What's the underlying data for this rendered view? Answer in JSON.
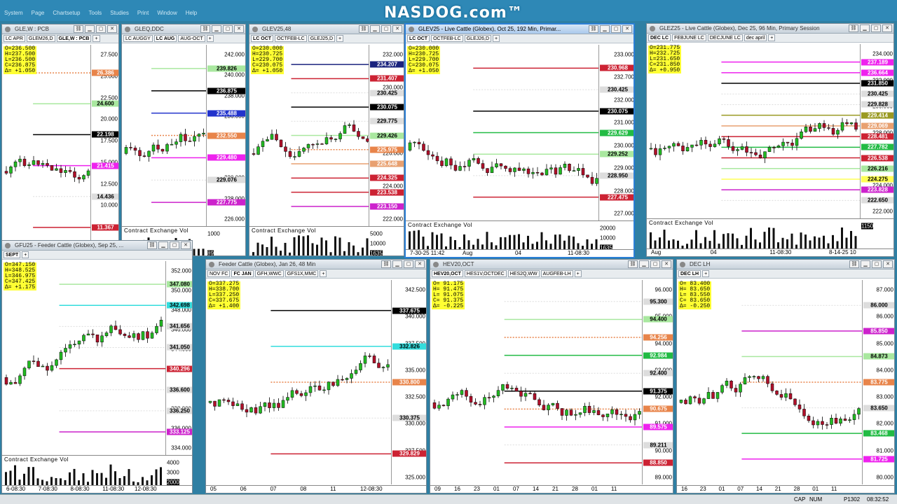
{
  "app": {
    "logo": "NASDOG.com™",
    "menu": [
      "System",
      "Page",
      "Chartsetup",
      "Tools",
      "Studies",
      "Print",
      "Window",
      "Help"
    ]
  },
  "statusbar": {
    "caps": "CAP",
    "num": "NUM",
    "page": "P1302",
    "time": "08:32:52"
  },
  "windows": [
    {
      "id": "w1",
      "title": "GLE,W : PCB",
      "tabs": [
        "LC APR",
        "GLEM26,D",
        "GLE,W : PCB"
      ],
      "sel": 2,
      "ohlc": [
        "O=236.500",
        "H=237.500",
        "L=236.500",
        "C=236.875",
        "Δ= +1.050"
      ],
      "prices": [
        "27.500",
        "25.000",
        "22.500",
        "20.000",
        "17.500",
        "15.000",
        "12.500",
        "10.000",
        "7.500",
        "5.000"
      ],
      "tags": [
        {
          "t": "26.386",
          "c": "#e8844a"
        },
        {
          "t": "24.600",
          "c": "#a9e89f"
        },
        {
          "t": "22.198",
          "c": "#000000",
          "f": "#ffffff"
        },
        {
          "t": "21.415",
          "c": "#ee22ee"
        },
        {
          "t": "14.436",
          "c": "#dddddd"
        },
        {
          "t": "11.367",
          "c": "#cc2233"
        }
      ],
      "xlabels": [],
      "vol_title": ""
    },
    {
      "id": "w2",
      "title": "GLEQ,DDC",
      "tabs": [
        "LC AUGGY",
        "LC AUG",
        "AUG-OCT"
      ],
      "sel": 1,
      "ohlc": [],
      "prices": [
        "242.000",
        "240.000",
        "238.000",
        "236.000",
        "234.000",
        "232.000",
        "230.000",
        "228.000",
        "226.000"
      ],
      "tags": [
        {
          "t": "239.826",
          "c": "#a9e89f"
        },
        {
          "t": "236.875",
          "c": "#000000",
          "f": "#ffffff"
        },
        {
          "t": "235.488",
          "c": "#2233cc"
        },
        {
          "t": "232.550",
          "c": "#e8844a"
        },
        {
          "t": "229.480",
          "c": "#ee22ee"
        },
        {
          "t": "229.076",
          "c": "#dddddd"
        },
        {
          "t": "227.775",
          "c": "#cc22cc"
        }
      ],
      "xlabels": [],
      "vol_title": "Contract Exchange Vol",
      "vol_scale": [
        "1000",
        "89"
      ]
    },
    {
      "id": "w3",
      "title": "GLEV25,48",
      "tabs": [
        "LC OCT",
        "OCTFEB-LC",
        "GLEJ25,D"
      ],
      "sel": 0,
      "ohlc": [
        "O=230.000",
        "H=230.725",
        "L=229.700",
        "C=230.075",
        "Δ= +1.050"
      ],
      "prices": [
        "232.000",
        "230.000",
        "228.000",
        "226.000",
        "224.000",
        "222.000"
      ],
      "tags": [
        {
          "t": "234.207",
          "c": "#1a237e"
        },
        {
          "t": "231.407",
          "c": "#cc2233"
        },
        {
          "t": "230.425",
          "c": "#dddddd"
        },
        {
          "t": "230.075",
          "c": "#000000",
          "f": "#ffffff"
        },
        {
          "t": "229.775",
          "c": "#dddddd"
        },
        {
          "t": "229.426",
          "c": "#a9e89f"
        },
        {
          "t": "225.975",
          "c": "#e8844a"
        },
        {
          "t": "225.648",
          "c": "#e8a070"
        },
        {
          "t": "224.325",
          "c": "#cc2233"
        },
        {
          "t": "223.538",
          "c": "#cc2233"
        },
        {
          "t": "223.150",
          "c": "#cc22cc"
        }
      ],
      "xlabels": [],
      "vol_title": "Contract Exchange Vol",
      "vol_scale": [
        "5000",
        "10000",
        "1635"
      ]
    },
    {
      "id": "w4",
      "title": "GLEV25 - Live Cattle (Globex), Oct 25, 192 Min, Primar...",
      "tabs": [
        "LC OCT",
        "OCTFEB-LC",
        "GLEJ26,D"
      ],
      "sel": 0,
      "ohlc": [
        "O=230.000",
        "H=230.725",
        "L=229.700",
        "C=230.075",
        "Δ= +1.050"
      ],
      "prices": [
        "233.000",
        "232.700",
        "232.000",
        "231.000",
        "230.000",
        "229.000",
        "228.000",
        "227.000"
      ],
      "tags": [
        {
          "t": "230.968",
          "c": "#cc2233"
        },
        {
          "t": "230.425",
          "c": "#dddddd"
        },
        {
          "t": "230.075",
          "c": "#000000",
          "f": "#ffffff"
        },
        {
          "t": "229.629",
          "c": "#22bb44"
        },
        {
          "t": "229.252",
          "c": "#a9e89f"
        },
        {
          "t": "228.950",
          "c": "#dddddd"
        },
        {
          "t": "227.475",
          "c": "#cc2233"
        }
      ],
      "xlabels": [
        "7-30-25 11:42",
        "Aug",
        "04",
        "11-08:30"
      ],
      "vol_title": "Contract Exchange Vol",
      "vol_scale": [
        "20000",
        "10000",
        "1635"
      ]
    },
    {
      "id": "w5",
      "title": "GLEZ25 - Live Cattle (Globex), Dec 25, 96 Min, Primary Session",
      "tabs": [
        "DEC LC",
        "FEBJUNE LC",
        "DECJUNE LC",
        "dec april"
      ],
      "sel": 0,
      "ohlc": [
        "O=231.775",
        "H=232.725",
        "L=231.650",
        "C=231.850",
        "Δ= +0.950"
      ],
      "prices": [
        "234.000",
        "232.000",
        "230.000",
        "228.000",
        "226.000",
        "224.000",
        "222.000"
      ],
      "tags": [
        {
          "t": "237.189",
          "c": "#ee22ee"
        },
        {
          "t": "236.664",
          "c": "#ee22ee"
        },
        {
          "t": "231.850",
          "c": "#000000",
          "f": "#ffffff"
        },
        {
          "t": "230.425",
          "c": "#dddddd"
        },
        {
          "t": "229.828",
          "c": "#dddddd"
        },
        {
          "t": "229.414",
          "c": "#9a9a22"
        },
        {
          "t": "229.069",
          "c": "#e8a070"
        },
        {
          "t": "228.481",
          "c": "#cc2233"
        },
        {
          "t": "227.782",
          "c": "#22bb44"
        },
        {
          "t": "226.538",
          "c": "#cc2233"
        },
        {
          "t": "226.216",
          "c": "#a9e89f"
        },
        {
          "t": "224.275",
          "c": "#ffff55"
        },
        {
          "t": "223.828",
          "c": "#cc22cc"
        },
        {
          "t": "222.650",
          "c": "#dddddd"
        }
      ],
      "xlabels": [
        "Aug",
        "04",
        "11-08:30",
        "8-14-25 10"
      ],
      "vol_title": "Contract Exchange Vol",
      "vol_scale": [
        "1150"
      ]
    },
    {
      "id": "w6",
      "title": "GFU25 - Feeder Cattle (Globex), Sep 25, ...",
      "tabs": [
        "SEPT"
      ],
      "sel": 0,
      "ohlc": [
        "O=347.150",
        "H=348.525",
        "L=346.975",
        "C=347.425",
        "Δ= +1.175"
      ],
      "prices": [
        "352.000",
        "350.000",
        "348.000",
        "346.000",
        "344.000",
        "342.000",
        "340.000",
        "338.000",
        "336.000",
        "334.000"
      ],
      "tags": [
        {
          "t": "347.080",
          "c": "#a9e89f"
        },
        {
          "t": "342.698",
          "c": "#33dddd"
        },
        {
          "t": "341.656",
          "c": "#dddddd"
        },
        {
          "t": "341.050",
          "c": "#dddddd"
        },
        {
          "t": "340.296",
          "c": "#cc2233"
        },
        {
          "t": "336.600",
          "c": "#dddddd"
        },
        {
          "t": "336.250",
          "c": "#dddddd"
        },
        {
          "t": "333.125",
          "c": "#cc22cc"
        }
      ],
      "xlabels": [
        "6-08:30",
        "7-08:30",
        "8-08:30",
        "11-08:30",
        "12-08:30"
      ],
      "vol_title": "Contract Exchange Vol",
      "vol_scale": [
        "4000",
        "3000",
        "2000"
      ]
    },
    {
      "id": "w7",
      "title": "Feeder Cattle (Globex), Jan 26, 48 Min",
      "tabs": [
        "NOV FC",
        "FC JAN",
        "GFH,WWC",
        "GFS1X,MMC"
      ],
      "sel": 1,
      "ohlc": [
        "O=337.275",
        "H=338.700",
        "L=337.250",
        "C=337.675",
        "Δ= +1.400"
      ],
      "prices": [
        "342.500",
        "340.000",
        "337.500",
        "335.000",
        "332.500",
        "330.000",
        "327.500",
        "325.000"
      ],
      "tags": [
        {
          "t": "337.675",
          "c": "#000000",
          "f": "#ffffff"
        },
        {
          "t": "332.826",
          "c": "#33dddd"
        },
        {
          "t": "330.800",
          "c": "#e8844a"
        },
        {
          "t": "330.375",
          "c": "#dddddd"
        },
        {
          "t": "329.829",
          "c": "#cc2233"
        }
      ],
      "xlabels": [
        "05",
        "06",
        "07",
        "08",
        "11",
        "12-08:30"
      ],
      "vol_title": ""
    },
    {
      "id": "w8",
      "title": "HEV20,OCT",
      "tabs": [
        "HEV20,OCT",
        "HES1V,OCTDEC",
        "HES2Q,WW",
        "AUGFEB-LH"
      ],
      "sel": 0,
      "ohlc": [
        "O= 91.175",
        "H= 91.475",
        "L= 91.075",
        "C= 91.375",
        "Δ= -0.225"
      ],
      "prices": [
        "96.000",
        "95.000",
        "94.000",
        "93.000",
        "92.000",
        "91.000",
        "90.000",
        "89.000"
      ],
      "tags": [
        {
          "t": "95.300",
          "c": "#dddddd"
        },
        {
          "t": "94.400",
          "c": "#a9e89f"
        },
        {
          "t": "94.256",
          "c": "#e8844a"
        },
        {
          "t": "92.984",
          "c": "#22bb44"
        },
        {
          "t": "92.400",
          "c": "#dddddd"
        },
        {
          "t": "91.375",
          "c": "#000000",
          "f": "#ffffff"
        },
        {
          "t": "90.675",
          "c": "#e8844a"
        },
        {
          "t": "89.575",
          "c": "#ee22ee"
        },
        {
          "t": "89.211",
          "c": "#dddddd"
        },
        {
          "t": "88.850",
          "c": "#cc2233"
        }
      ],
      "xlabels": [
        "09",
        "16",
        "23",
        "01",
        "07",
        "14",
        "21",
        "28",
        "01",
        "11"
      ],
      "vol_title": ""
    },
    {
      "id": "w9",
      "title": "DEC LH",
      "tabs": [
        "DEC LH"
      ],
      "sel": 0,
      "ohlc": [
        "O= 83.400",
        "H= 83.650",
        "L= 83.550",
        "C= 83.650",
        "Δ= -0.250"
      ],
      "prices": [
        "87.000",
        "86.000",
        "85.000",
        "84.000",
        "83.000",
        "82.000",
        "81.000",
        "80.000"
      ],
      "tags": [
        {
          "t": "86.000",
          "c": "#dddddd"
        },
        {
          "t": "85.850",
          "c": "#cc22cc"
        },
        {
          "t": "84.873",
          "c": "#a9e89f"
        },
        {
          "t": "83.775",
          "c": "#e8844a"
        },
        {
          "t": "83.650",
          "c": "#dddddd"
        },
        {
          "t": "83.468",
          "c": "#22bb44"
        },
        {
          "t": "81.725",
          "c": "#ee22ee"
        }
      ],
      "xlabels": [
        "16",
        "23",
        "01",
        "07",
        "14",
        "21",
        "28",
        "01",
        "11"
      ],
      "vol_title": ""
    }
  ]
}
